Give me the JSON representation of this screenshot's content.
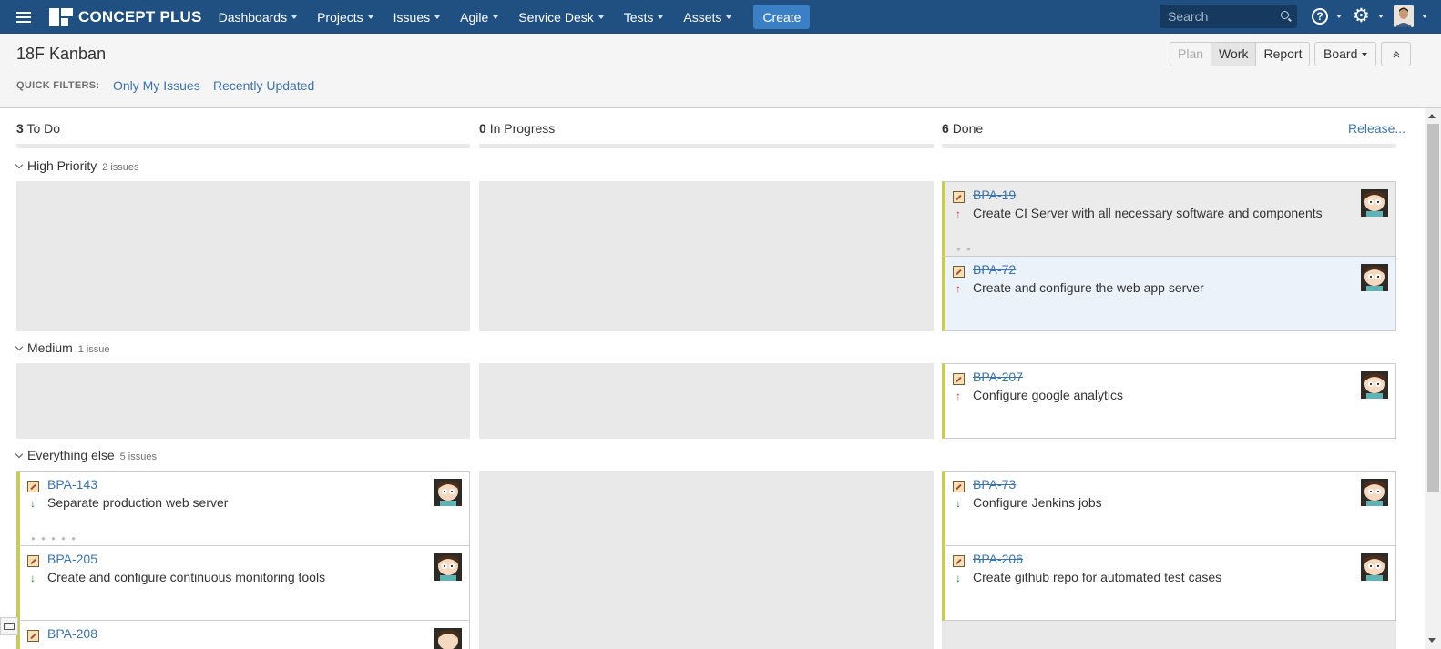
{
  "topnav": {
    "logo_text": "CONCEPT PLUS",
    "menus": [
      {
        "label": "Dashboards"
      },
      {
        "label": "Projects"
      },
      {
        "label": "Issues"
      },
      {
        "label": "Agile"
      },
      {
        "label": "Service Desk"
      },
      {
        "label": "Tests"
      },
      {
        "label": "Assets"
      }
    ],
    "create_label": "Create",
    "search_placeholder": "Search",
    "help_glyph": "?"
  },
  "header": {
    "board_title": "18F Kanban",
    "quick_filters_label": "QUICK FILTERS:",
    "quick_filters": [
      "Only My Issues",
      "Recently Updated"
    ],
    "mode_buttons": [
      "Plan",
      "Work",
      "Report"
    ],
    "active_mode": "Work",
    "board_menu_label": "Board"
  },
  "columns": [
    {
      "count": "3",
      "name": "To Do"
    },
    {
      "count": "0",
      "name": "In Progress"
    },
    {
      "count": "6",
      "name": "Done"
    }
  ],
  "release_link": "Release...",
  "swimlanes": [
    {
      "name": "High Priority",
      "count_label": "2 issues"
    },
    {
      "name": "Medium",
      "count_label": "1 issue"
    },
    {
      "name": "Everything else",
      "count_label": "5 issues"
    }
  ],
  "cards": {
    "bpa19": {
      "key": "BPA-19",
      "summary": "Create CI Server with all necessary software and components",
      "priority": "up"
    },
    "bpa72": {
      "key": "BPA-72",
      "summary": "Create and configure the web app server",
      "priority": "up"
    },
    "bpa207": {
      "key": "BPA-207",
      "summary": "Configure google analytics",
      "priority": "up"
    },
    "bpa143": {
      "key": "BPA-143",
      "summary": "Separate production web server",
      "priority": "down"
    },
    "bpa205": {
      "key": "BPA-205",
      "summary": "Create and configure continuous monitoring tools",
      "priority": "down"
    },
    "bpa208": {
      "key": "BPA-208",
      "summary": "",
      "priority": "down"
    },
    "bpa73": {
      "key": "BPA-73",
      "summary": "Configure Jenkins jobs",
      "priority": "down"
    },
    "bpa206": {
      "key": "BPA-206",
      "summary": "Create github repo for automated test cases",
      "priority": "down"
    }
  },
  "icons": {
    "priority_up": "↑",
    "priority_down": "↓",
    "gear": "⚙"
  },
  "colors": {
    "nav_bg": "#205081",
    "link": "#3b73af",
    "card_edge": "#c8cb5c",
    "priority_high": "#d04437",
    "priority_low": "#14892c"
  }
}
